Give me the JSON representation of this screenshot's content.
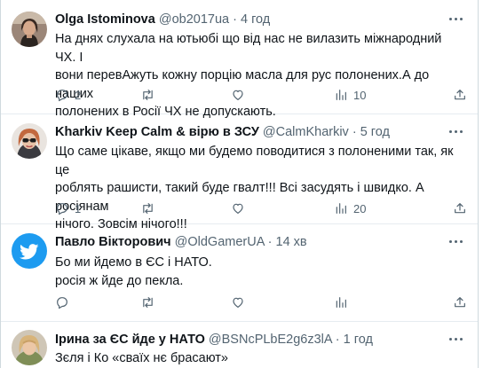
{
  "tweets": [
    {
      "name": "Olga Istominova",
      "handle": "@ob2017ua",
      "dot": "·",
      "time": "4 год",
      "lines": [
        "На днях слухала на ютьюбі що від нас не вилазить міжнародний ЧХ. І",
        "вони перевАжуть кожну порцію масла для рус полонених.А до наших",
        "полонених в Росії ЧХ не допускають."
      ],
      "replies": "2",
      "retweets": "",
      "likes": "",
      "views": "10"
    },
    {
      "name": "Kharkiv Keep Calm & вірю в ЗСУ",
      "handle": "@CalmKharkiv",
      "dot": "·",
      "time": "5 год",
      "lines": [
        "Що саме цікаве, якщо ми будемо поводитися з полоненими так, як це",
        "роблять рашисти, такий буде гвалт!!! Всі засудять і швидко. А росіянам",
        "нічого. Зовсім нічого!!!"
      ],
      "replies": "1",
      "retweets": "",
      "likes": "",
      "views": "20"
    },
    {
      "name": "Павло Вікторович",
      "handle": "@OldGamerUA",
      "dot": "·",
      "time": "14 хв",
      "lines": [
        "Бо ми йдемо в ЄС і НАТО.",
        "росія ж йде до пекла."
      ],
      "replies": "",
      "retweets": "",
      "likes": "",
      "views": ""
    },
    {
      "name": "Ірина за ЄС йде у НАТО",
      "handle": "@BSNcPLbE2g6z3lA",
      "dot": "·",
      "time": "1 год",
      "lines": [
        "Зєля і Ко «сваїх нє брасают»"
      ]
    }
  ],
  "icons": {
    "more": "more-icon",
    "reply": "reply-icon",
    "retweet": "retweet-icon",
    "like": "heart-icon",
    "views": "views-icon",
    "share": "share-icon"
  },
  "colors": {
    "text": "#0f1419",
    "muted": "#536471",
    "twitter_blue": "#1d9bf0",
    "divider": "#e6ecf0"
  }
}
